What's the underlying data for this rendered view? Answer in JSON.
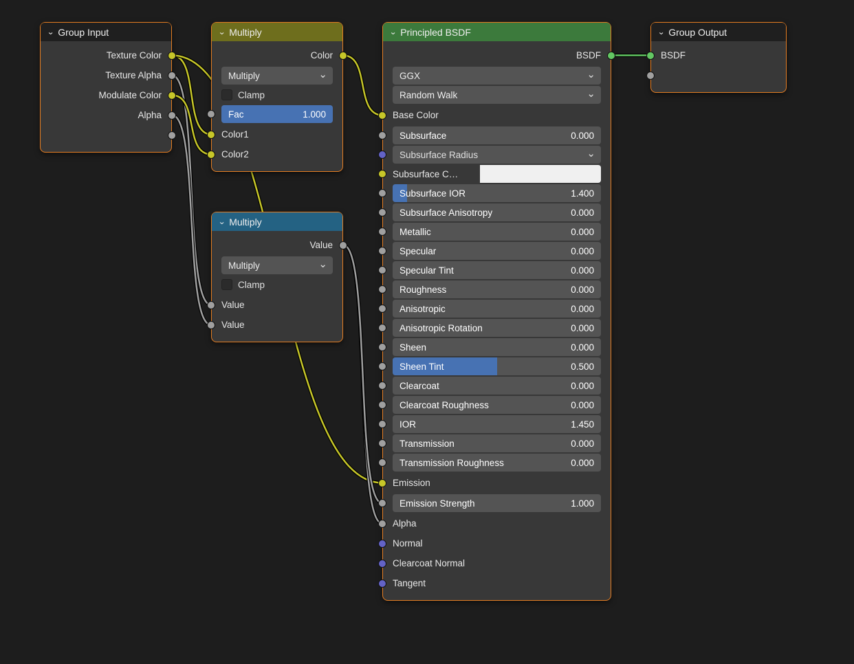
{
  "nodes": {
    "group_input": {
      "title": "Group Input",
      "header_color": "#1f1f1f",
      "outputs": [
        "Texture Color",
        "Texture Alpha",
        "Modulate Color",
        "Alpha",
        ""
      ]
    },
    "mix_rgb": {
      "title": "Multiply",
      "header_color": "#6e6e1d",
      "output": "Color",
      "blend_mode": "Multiply",
      "clamp_label": "Clamp",
      "fac": {
        "label": "Fac",
        "value": "1.000",
        "fill": 1.0
      },
      "color1": "Color1",
      "color2": "Color2"
    },
    "math": {
      "title": "Multiply",
      "header_color": "#246283",
      "output": "Value",
      "operation": "Multiply",
      "clamp_label": "Clamp",
      "value_a": "Value",
      "value_b": "Value"
    },
    "bsdf": {
      "title": "Principled BSDF",
      "header_color": "#3c7a3c",
      "output": "BSDF",
      "distribution": "GGX",
      "subsurface_method": "Random Walk",
      "base_color": "Base Color",
      "subsurface_color_label": "Subsurface C…",
      "subsurface_color_swatch": "#f0f0f0",
      "params": [
        {
          "label": "Subsurface",
          "value": "0.000",
          "fill": 0
        },
        {
          "label": "Subsurface Radius",
          "select": true
        },
        {
          "label": "Subsurface IOR",
          "value": "1.400",
          "fill": 0.07
        },
        {
          "label": "Subsurface Anisotropy",
          "value": "0.000",
          "fill": 0
        },
        {
          "label": "Metallic",
          "value": "0.000",
          "fill": 0
        },
        {
          "label": "Specular",
          "value": "0.000",
          "fill": 0
        },
        {
          "label": "Specular Tint",
          "value": "0.000",
          "fill": 0
        },
        {
          "label": "Roughness",
          "value": "0.000",
          "fill": 0
        },
        {
          "label": "Anisotropic",
          "value": "0.000",
          "fill": 0
        },
        {
          "label": "Anisotropic Rotation",
          "value": "0.000",
          "fill": 0
        },
        {
          "label": "Sheen",
          "value": "0.000",
          "fill": 0
        },
        {
          "label": "Sheen Tint",
          "value": "0.500",
          "fill": 0.5
        },
        {
          "label": "Clearcoat",
          "value": "0.000",
          "fill": 0
        },
        {
          "label": "Clearcoat Roughness",
          "value": "0.000",
          "fill": 0
        },
        {
          "label": "IOR",
          "value": "1.450",
          "fill": 0
        },
        {
          "label": "Transmission",
          "value": "0.000",
          "fill": 0
        },
        {
          "label": "Transmission Roughness",
          "value": "0.000",
          "fill": 0
        }
      ],
      "emission": "Emission",
      "emission_strength": {
        "label": "Emission Strength",
        "value": "1.000",
        "fill": 0
      },
      "alpha": "Alpha",
      "normal": "Normal",
      "clearcoat_normal": "Clearcoat Normal",
      "tangent": "Tangent"
    },
    "group_output": {
      "title": "Group Output",
      "header_color": "#1f1f1f",
      "input": "BSDF"
    }
  },
  "wires": [
    {
      "from": "gi-tex-color",
      "to": "mix-color1",
      "color": "#c7c729"
    },
    {
      "from": "gi-tex-color",
      "to": "bsdf-emission",
      "color": "#c7c729"
    },
    {
      "from": "gi-tex-alpha",
      "to": "math-a",
      "color": "#a0a0a0"
    },
    {
      "from": "gi-mod-color",
      "to": "mix-color2",
      "color": "#c7c729"
    },
    {
      "from": "gi-alpha",
      "to": "math-b",
      "color": "#a0a0a0"
    },
    {
      "from": "mix-out",
      "to": "bsdf-base",
      "color": "#c7c729"
    },
    {
      "from": "math-out",
      "to": "bsdf-alpha",
      "color": "#a0a0a0"
    },
    {
      "from": "math-out",
      "to": "bsdf-emstr",
      "color": "#a0a0a0"
    },
    {
      "from": "bsdf-out",
      "to": "go-bsdf",
      "color": "#63c763"
    }
  ]
}
